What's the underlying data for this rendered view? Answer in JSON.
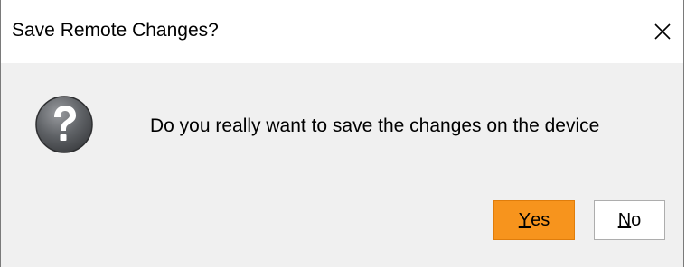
{
  "window": {
    "title": "Save Remote Changes?",
    "close_icon": "close-icon"
  },
  "dialog": {
    "icon": "question-icon",
    "message": "Do you really want to save the changes on the device"
  },
  "buttons": {
    "yes": {
      "mnemonic": "Y",
      "rest": "es",
      "selected": true
    },
    "no": {
      "mnemonic": "N",
      "rest": "o",
      "selected": false
    }
  },
  "colors": {
    "accent": "#f7941d",
    "background": "#f0f0f0",
    "titlebar": "#ffffff"
  }
}
